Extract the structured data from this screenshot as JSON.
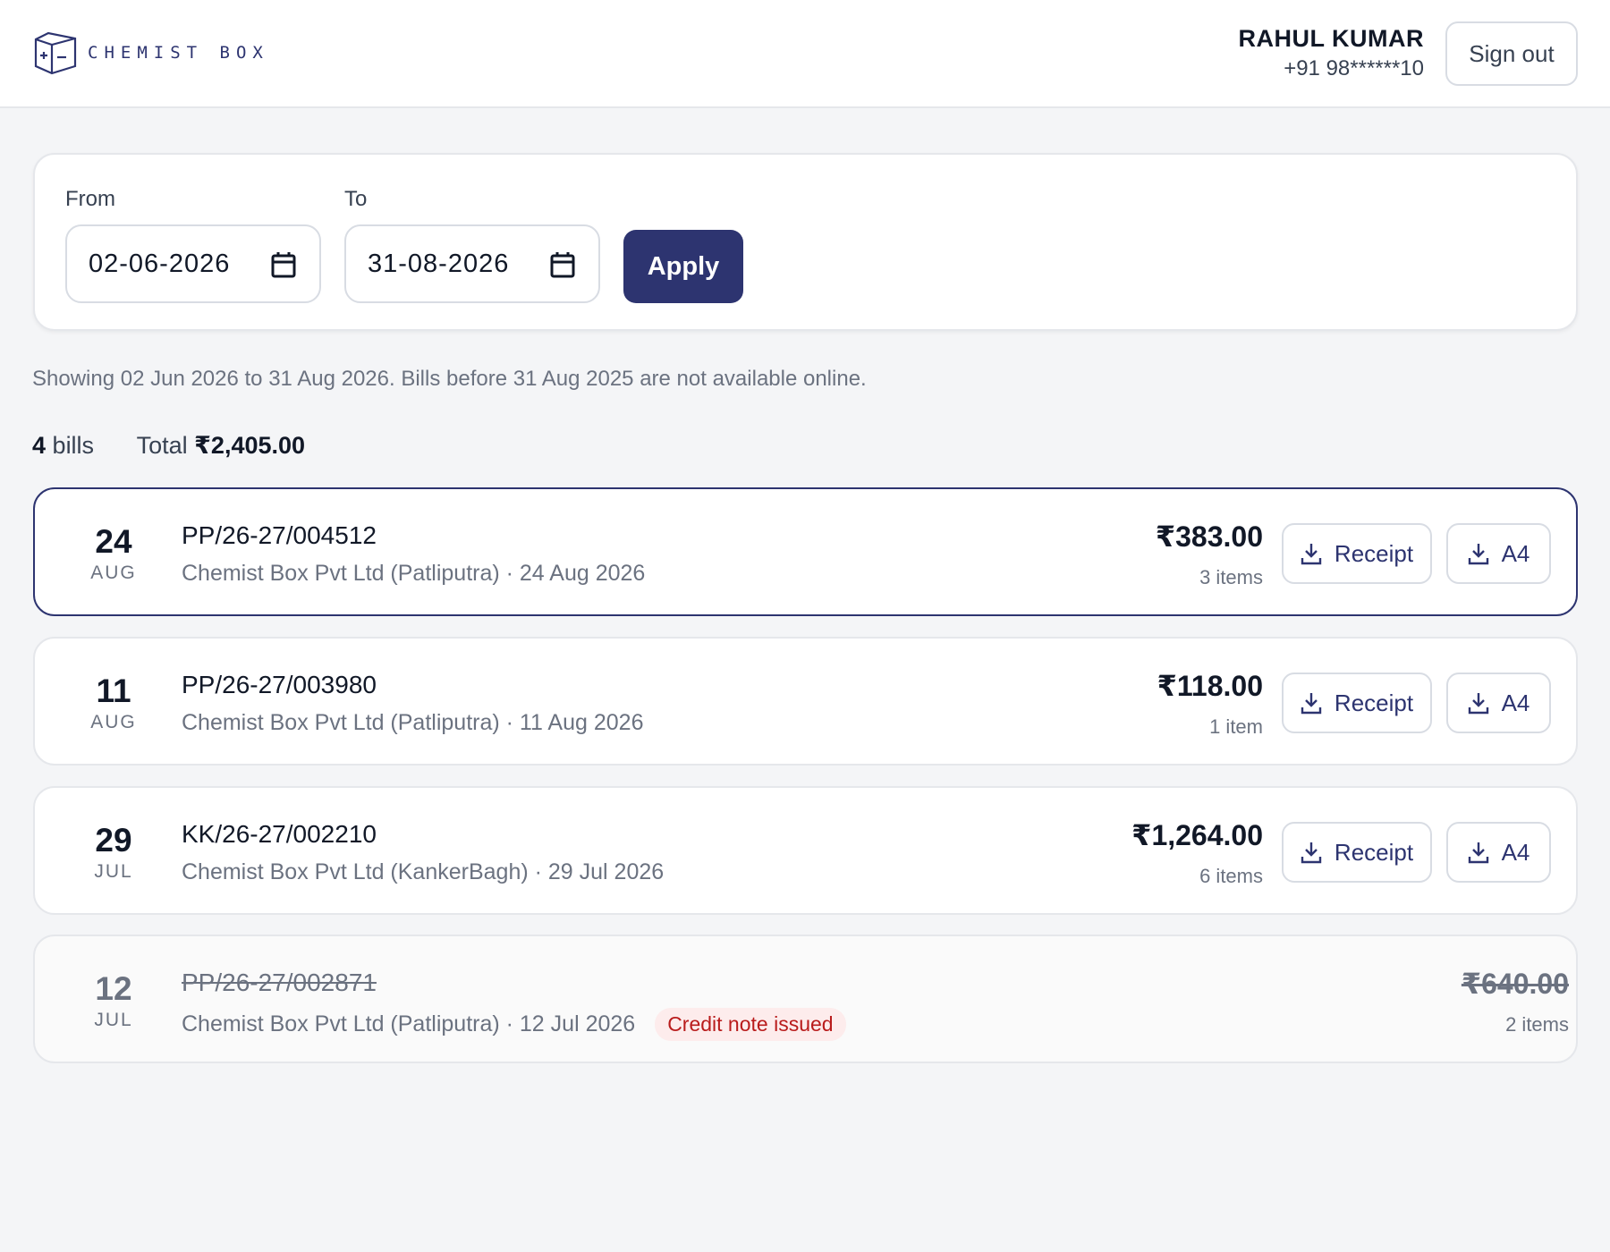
{
  "header": {
    "brand": "CHEMIST BOX",
    "user_name": "RAHUL KUMAR",
    "user_phone": "+91 98******10",
    "signout_label": "Sign out"
  },
  "filter": {
    "from_label": "From",
    "from_value": "02-06-2026",
    "to_label": "To",
    "to_value": "31-08-2026",
    "apply_label": "Apply"
  },
  "notice": "Showing 02 Jun 2026 to 31 Aug 2026. Bills before 31 Aug 2025 are not available online.",
  "summary": {
    "count": "4",
    "count_label": "bills",
    "total_label": "Total",
    "total_value": "₹2,405.00"
  },
  "bills": [
    {
      "day": "24",
      "month": "AUG",
      "number": "PP/26-27/004512",
      "meta": "Chemist Box Pvt Ltd (Patliputra) · 24 Aug 2026",
      "amount": "₹383.00",
      "items": "3 items",
      "receipt_label": "Receipt",
      "a4_label": "A4"
    },
    {
      "day": "11",
      "month": "AUG",
      "number": "PP/26-27/003980",
      "meta": "Chemist Box Pvt Ltd (Patliputra) · 11 Aug 2026",
      "amount": "₹118.00",
      "items": "1 item",
      "receipt_label": "Receipt",
      "a4_label": "A4"
    },
    {
      "day": "29",
      "month": "JUL",
      "number": "KK/26-27/002210",
      "meta": "Chemist Box Pvt Ltd (KankerBagh) · 29 Jul 2026",
      "amount": "₹1,264.00",
      "items": "6 items",
      "receipt_label": "Receipt",
      "a4_label": "A4"
    },
    {
      "day": "12",
      "month": "JUL",
      "number": "PP/26-27/002871",
      "meta": "Chemist Box Pvt Ltd (Patliputra) · 12 Jul 2026",
      "badge": "Credit note issued",
      "amount": "₹640.00",
      "items": "2 items"
    }
  ],
  "icons": {
    "logo": "box-icon",
    "calendar": "calendar-icon",
    "download": "download-icon"
  },
  "colors": {
    "brand": "#2d3470",
    "badge_bg": "#fdecec",
    "badge_text": "#b91c1c"
  }
}
